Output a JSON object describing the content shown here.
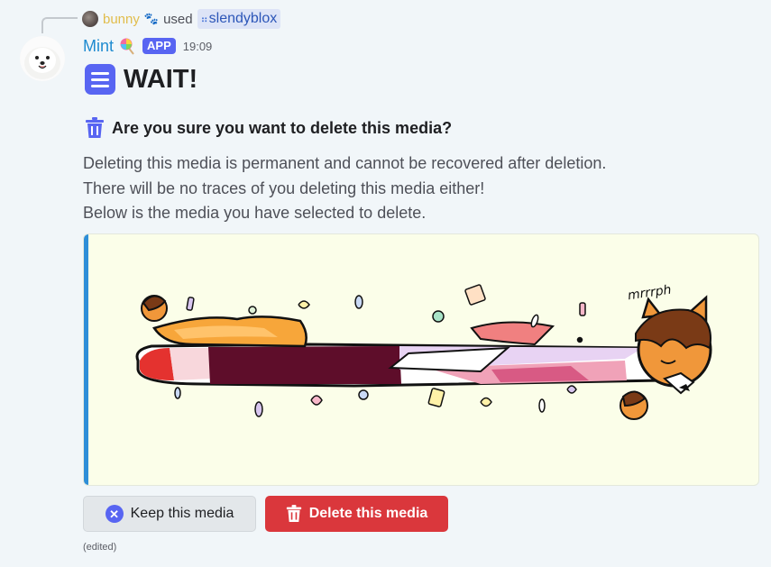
{
  "reply": {
    "user": "bunny",
    "paw_icon": "paw-icon",
    "used": "used",
    "command": "slendyblox"
  },
  "message": {
    "author": "Mint",
    "author_color": "#1f8bd0",
    "badge": "APP",
    "timestamp": "19:09",
    "edited": "(edited)"
  },
  "embed": {
    "title": "WAIT!",
    "question": "Are you sure you want to delete this media?",
    "description": [
      "Deleting this media is permanent and cannot be recovered after deletion.",
      "There will be no traces of you deleting this media either!",
      "Below is the media you have selected to delete."
    ],
    "accent_color": "#2e8ed8",
    "media_text": "mrrrph"
  },
  "buttons": {
    "keep": "Keep this media",
    "delete": "Delete this media"
  },
  "colors": {
    "blurple": "#5865f2",
    "danger": "#da373c",
    "reply_user": "#e1bd4c"
  }
}
